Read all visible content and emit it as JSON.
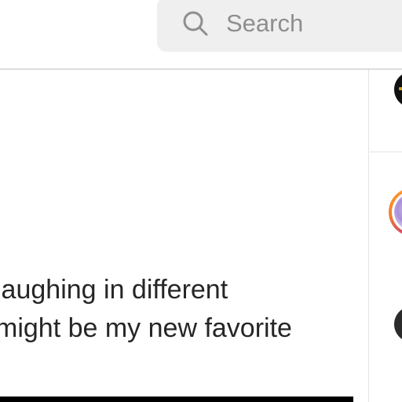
{
  "search": {
    "placeholder": "Search",
    "icon": "search-icon"
  },
  "post": {
    "caption_line1": "laughing in different",
    "caption_line2": "might be my new favorite"
  },
  "colors": {
    "search_bg": "#efefef",
    "placeholder_text": "#8e8e8e",
    "caption_text": "#262626",
    "divider": "#dcdcdc",
    "story_ring": [
      "#f9a13a",
      "#ee2a7b",
      "#c13584"
    ]
  },
  "sidebar": {
    "avatars": [
      "avatar",
      "story-avatar",
      "avatar"
    ]
  }
}
